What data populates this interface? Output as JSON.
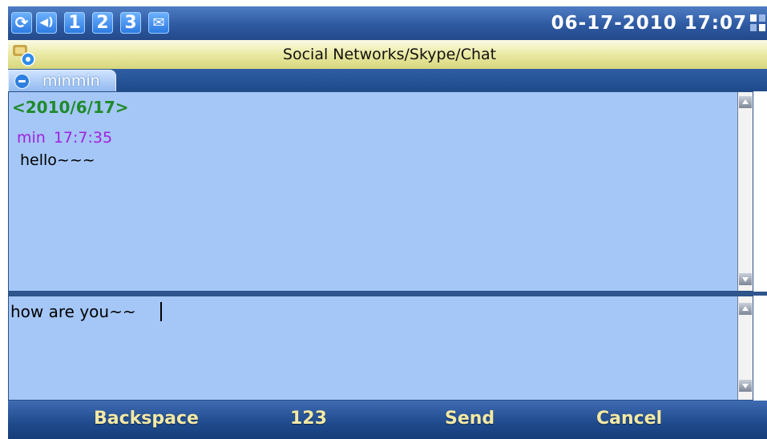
{
  "status_bar": {
    "icons": [
      {
        "name": "sync-icon",
        "glyph": "↻"
      },
      {
        "name": "volume-icon",
        "glyph": "◀"
      },
      {
        "name": "line-1-icon",
        "glyph": "1"
      },
      {
        "name": "line-2-icon",
        "glyph": "2"
      },
      {
        "name": "line-3-icon",
        "glyph": "3"
      },
      {
        "name": "message-icon",
        "glyph": "✉"
      }
    ],
    "datetime": "06-17-2010 17:07"
  },
  "title_bar": {
    "title": "Social Networks/Skype/Chat"
  },
  "tab": {
    "label": "minmin"
  },
  "chat": {
    "date_header": "<2010/6/17>",
    "messages": [
      {
        "sender": "min",
        "time": "17:7:35",
        "text": "hello~~~"
      }
    ]
  },
  "input": {
    "value": "how are you~~"
  },
  "softkeys": {
    "backspace": "Backspace",
    "mode": "123",
    "send": "Send",
    "cancel": "Cancel"
  },
  "colors": {
    "accent": "#2e5aa2",
    "chat_background": "#a5c7f7",
    "date_color": "#1f8a2a",
    "sender_color": "#a020e0",
    "softkey_text": "#f3e9a6"
  }
}
